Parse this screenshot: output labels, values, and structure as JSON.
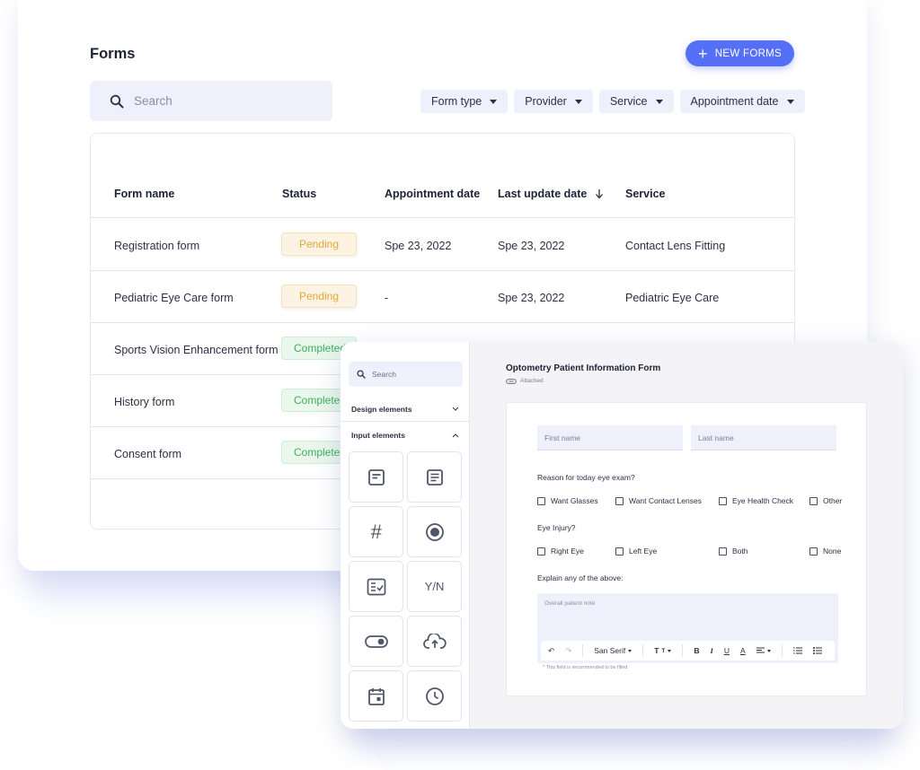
{
  "forms": {
    "title": "Forms",
    "new_button": "NEW FORMS",
    "search_placeholder": "Search",
    "filters": [
      "Form type",
      "Provider",
      "Service",
      "Appointment date"
    ],
    "columns": [
      "Form name",
      "Status",
      "Appointment date",
      "Last update date",
      "Service"
    ],
    "rows": [
      {
        "name": "Registration form",
        "status": "Pending",
        "appointment": "Spe 23, 2022",
        "updated": "Spe 23, 2022",
        "service": "Contact Lens Fitting"
      },
      {
        "name": "Pediatric Eye Care form",
        "status": "Pending",
        "appointment": "-",
        "updated": "Spe 23, 2022",
        "service": "Pediatric Eye Care"
      },
      {
        "name": "Sports Vision Enhancement form",
        "status": "Completed"
      },
      {
        "name": "History form",
        "status": "Completed"
      },
      {
        "name": "Consent form",
        "status": "Completed"
      }
    ],
    "status_colors": {
      "pending": "#e2a63a",
      "completed": "#3fae5b"
    },
    "accent": "#5570f6"
  },
  "builder": {
    "search_placeholder": "Search",
    "sections": [
      "Design elements",
      "Input elements"
    ],
    "tiles": [
      {
        "icon": "short-text-icon"
      },
      {
        "icon": "long-text-icon"
      },
      {
        "icon": "number-icon",
        "label": "#"
      },
      {
        "icon": "radio-icon"
      },
      {
        "icon": "checklist-icon"
      },
      {
        "icon": "yes-no-icon",
        "label": "Y/N"
      },
      {
        "icon": "toggle-icon"
      },
      {
        "icon": "upload-icon"
      },
      {
        "icon": "calendar-icon"
      },
      {
        "icon": "clock-icon"
      }
    ],
    "form_title": "Optometry Patient Information Form",
    "attached": "Attached",
    "first_name": "First name",
    "last_name": "Last name",
    "q1": "Reason for today eye exam?",
    "q1_options": [
      "Want Glasses",
      "Want Contact Lenses",
      "Eye Health Check",
      "Other"
    ],
    "q2": "Eye Injury?",
    "q2_options": [
      "Right Eye",
      "Left Eye",
      "Both",
      "None"
    ],
    "q3": "Explain any of the above:",
    "note_placeholder": "Overall patient note",
    "font": "San Serif",
    "hint": "* This field is recommended to be filled"
  }
}
